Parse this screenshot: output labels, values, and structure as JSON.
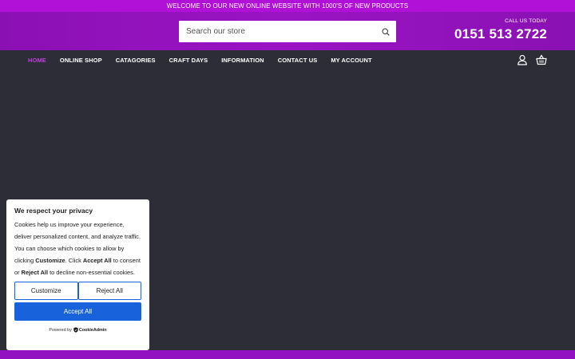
{
  "announcement": "WELCOME TO OUR NEW ONLINE WEBSITE WITH 1000'S OF NEW PRODUCTS",
  "search": {
    "placeholder": "Search our store"
  },
  "call": {
    "label": "CALL US TODAY",
    "phone": "0151 513 2722"
  },
  "nav": {
    "items": [
      {
        "label": "HOME",
        "active": true
      },
      {
        "label": "ONLINE SHOP"
      },
      {
        "label": "CATAGORIES"
      },
      {
        "label": "CRAFT DAYS"
      },
      {
        "label": "INFORMATION"
      },
      {
        "label": "CONTACT US"
      },
      {
        "label": "MY ACCOUNT"
      }
    ],
    "icons": [
      "user-icon",
      "basket-icon"
    ]
  },
  "cookie": {
    "title": "We respect your privacy",
    "text_1": "Cookies help us improve your experience, deliver personalized content, and analyze traffic. You can choose which cookies to allow by clicking ",
    "bold_1": "Customize",
    "text_2": ". Click ",
    "bold_2": "Accept All",
    "text_3": " to consent or ",
    "bold_3": "Reject All",
    "text_4": " to decline non-essential cookies.",
    "customize_label": "Customize",
    "reject_label": "Reject All",
    "accept_label": "Accept All",
    "powered_by": "Powered by",
    "brand": "CookieAdmin"
  },
  "colors": {
    "topbar": "#b111d6",
    "header": "#9a14c4",
    "nav_active": "#c13ee0",
    "background": "#2c2d36",
    "accept_button": "#1863dc"
  }
}
